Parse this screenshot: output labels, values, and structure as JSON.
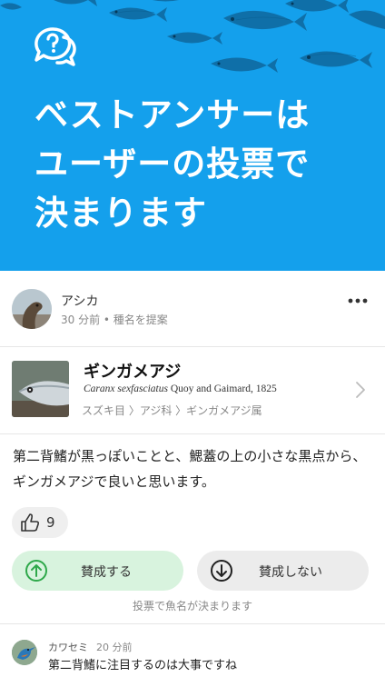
{
  "hero": {
    "title_lines": [
      "ベストアンサーは",
      "ユーザーの投票で",
      "決まります"
    ],
    "icon": "question-chat-icon",
    "background_color": "#14a0ec"
  },
  "post": {
    "user_name": "アシカ",
    "meta": "30 分前 • 種名を提案",
    "more_icon": "more-horizontal-icon"
  },
  "species": {
    "name": "ギンガメアジ",
    "scientific_name": "Caranx sexfasciatus",
    "author": "Quoy and Gaimard, 1825",
    "taxonomy": "スズキ目 〉アジ科 〉ギンガメアジ属"
  },
  "comment": "第二背鰭が黒っぽいことと、鰓蓋の上の小さな黒点から、ギンガメアジで良いと思います。",
  "like": {
    "count": "9",
    "icon": "thumbs-up-icon"
  },
  "vote": {
    "agree_label": "賛成する",
    "agree_icon": "arrow-up-circle-icon",
    "agree_color": "#d8f3de",
    "disagree_label": "賛成しない",
    "disagree_icon": "arrow-down-circle-icon",
    "note": "投票で魚名が決まります"
  },
  "reply": {
    "user_name": "カワセミ",
    "time": "20 分前",
    "text": "第二背鰭に注目するのは大事ですね"
  }
}
